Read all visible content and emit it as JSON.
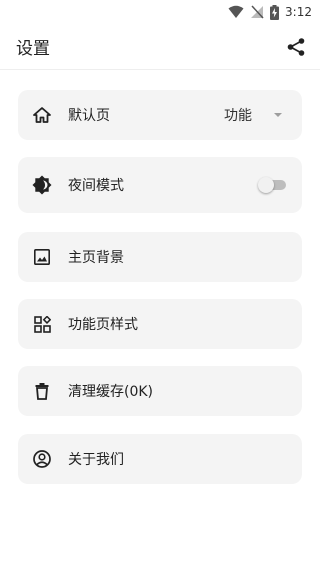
{
  "status_bar": {
    "time": "3:12"
  },
  "header": {
    "title": "设置"
  },
  "settings": {
    "default_page": {
      "label": "默认页",
      "value": "功能"
    },
    "night_mode": {
      "label": "夜间模式",
      "enabled": false
    },
    "home_background": {
      "label": "主页背景"
    },
    "function_page_style": {
      "label": "功能页样式"
    },
    "clear_cache": {
      "label": "清理缓存(0K)"
    },
    "about": {
      "label": "关于我们"
    }
  },
  "colors": {
    "card_background": "#f4f4f4",
    "icon": "#222222"
  }
}
